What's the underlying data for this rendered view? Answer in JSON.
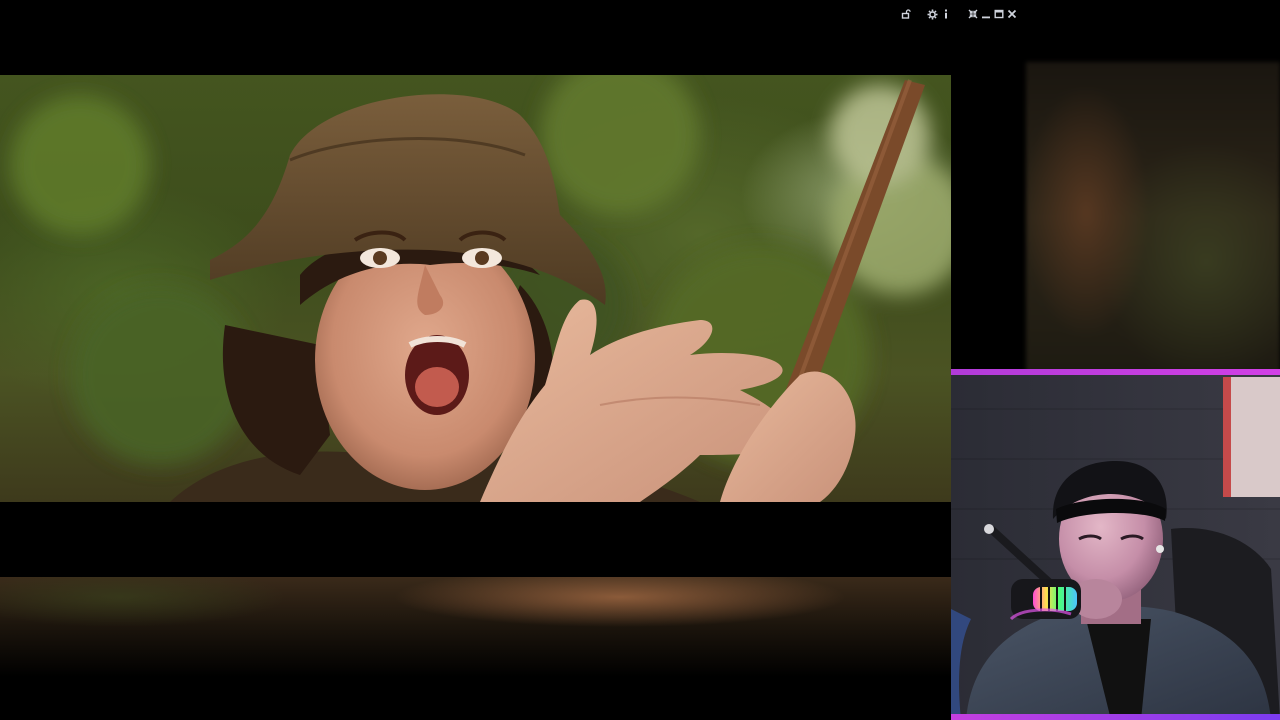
{
  "window_controls": {
    "items": [
      {
        "name": "unlock-icon"
      },
      {
        "name": "settings-icon"
      },
      {
        "name": "info-icon"
      },
      {
        "name": "collapse-icon"
      },
      {
        "name": "minimize-icon"
      },
      {
        "name": "maximize-icon"
      },
      {
        "name": "close-icon"
      }
    ],
    "color": "#cfd3dc"
  },
  "video": {
    "scene": "movie-frame"
  },
  "webcam": {
    "border_color": "#c43fe0"
  },
  "colors": {
    "background": "#000000",
    "accent": "#c43fe0"
  }
}
